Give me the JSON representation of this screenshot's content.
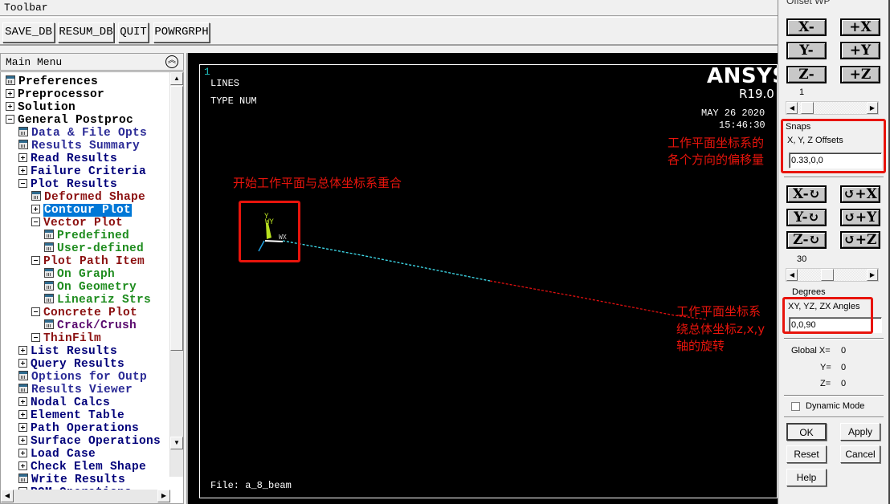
{
  "toolbar": {
    "title": "Toolbar",
    "buttons": [
      "SAVE_DB",
      "RESUM_DB",
      "QUIT",
      "POWRGRPH"
    ]
  },
  "main_menu": {
    "title": "Main Menu",
    "items": [
      {
        "label": "Preferences",
        "icon": "calc-icon",
        "level": 0,
        "color": "black"
      },
      {
        "label": "Preprocessor",
        "icon": "expand-icon",
        "level": 0,
        "color": "black"
      },
      {
        "label": "Solution",
        "icon": "expand-icon",
        "level": 0,
        "color": "black"
      },
      {
        "label": "General Postproc",
        "icon": "collapse-icon",
        "level": 0,
        "color": "black"
      },
      {
        "label": "Data & File Opts",
        "icon": "calc-icon",
        "level": 1,
        "color": "blue"
      },
      {
        "label": "Results Summary",
        "icon": "calc-icon",
        "level": 1,
        "color": "blue"
      },
      {
        "label": "Read Results",
        "icon": "expand-icon",
        "level": 1,
        "color": "navy"
      },
      {
        "label": "Failure Criteria",
        "icon": "expand-icon",
        "level": 1,
        "color": "navy"
      },
      {
        "label": "Plot Results",
        "icon": "collapse-icon",
        "level": 1,
        "color": "navy"
      },
      {
        "label": "Deformed Shape",
        "icon": "calc-icon",
        "level": 2,
        "color": "red"
      },
      {
        "label": "Contour Plot",
        "icon": "expand-icon",
        "level": 2,
        "color": "red",
        "selected": true
      },
      {
        "label": "Vector Plot",
        "icon": "collapse-icon",
        "level": 2,
        "color": "red"
      },
      {
        "label": "Predefined",
        "icon": "calc-icon",
        "level": 3,
        "color": "green"
      },
      {
        "label": "User-defined",
        "icon": "calc-icon",
        "level": 3,
        "color": "green"
      },
      {
        "label": "Plot Path Item",
        "icon": "collapse-icon",
        "level": 2,
        "color": "red"
      },
      {
        "label": "On Graph",
        "icon": "calc-icon",
        "level": 3,
        "color": "green"
      },
      {
        "label": "On Geometry",
        "icon": "calc-icon",
        "level": 3,
        "color": "green"
      },
      {
        "label": "Lineariz Strs",
        "icon": "calc-icon",
        "level": 3,
        "color": "green"
      },
      {
        "label": "Concrete Plot",
        "icon": "collapse-icon",
        "level": 2,
        "color": "red"
      },
      {
        "label": "Crack/Crush",
        "icon": "calc-icon",
        "level": 3,
        "color": "purple"
      },
      {
        "label": "ThinFilm",
        "icon": "collapse-icon",
        "level": 2,
        "color": "red"
      },
      {
        "label": "List Results",
        "icon": "expand-icon",
        "level": 1,
        "color": "navy"
      },
      {
        "label": "Query Results",
        "icon": "expand-icon",
        "level": 1,
        "color": "navy"
      },
      {
        "label": "Options for Outp",
        "icon": "calc-icon",
        "level": 1,
        "color": "blue"
      },
      {
        "label": "Results Viewer",
        "icon": "calc-icon",
        "level": 1,
        "color": "blue"
      },
      {
        "label": "Nodal Calcs",
        "icon": "expand-icon",
        "level": 1,
        "color": "navy"
      },
      {
        "label": "Element Table",
        "icon": "expand-icon",
        "level": 1,
        "color": "navy"
      },
      {
        "label": "Path Operations",
        "icon": "expand-icon",
        "level": 1,
        "color": "navy"
      },
      {
        "label": "Surface Operations",
        "icon": "expand-icon",
        "level": 1,
        "color": "navy"
      },
      {
        "label": "Load Case",
        "icon": "expand-icon",
        "level": 1,
        "color": "navy"
      },
      {
        "label": "Check Elem Shape",
        "icon": "expand-icon",
        "level": 1,
        "color": "navy"
      },
      {
        "label": "Write Results",
        "icon": "calc-icon",
        "level": 1,
        "color": "navy"
      },
      {
        "label": "ROM Operations",
        "icon": "expand-icon",
        "level": 1,
        "color": "navy"
      }
    ]
  },
  "graphics": {
    "window_number": "1",
    "plot_type": "LINES",
    "numbering": "TYPE NUM",
    "brand": "ANSYS",
    "release": "R19.0",
    "date": "MAY 26 2020",
    "time": "15:46:30",
    "file_label": "File: a_8_beam",
    "triad_labels": {
      "wy": "WY",
      "y": "Y",
      "wx": "WX"
    },
    "colors": {
      "line_cyan": "#40e0f0",
      "line_red": "#e01010",
      "triad_y": "#b8e020",
      "annotation": "#e8140c"
    }
  },
  "annotations": {
    "origin_note": "开始工作平面与总体坐标系重合",
    "offset_note": [
      "工作平面坐标系的",
      "各个方向的偏移量"
    ],
    "rotation_note": [
      "工作平面坐标系",
      "绕总体坐标z,x,y",
      "轴的旋转"
    ]
  },
  "offset_wp": {
    "title": "Offset WP",
    "translate_buttons": [
      "X-",
      "+X",
      "Y-",
      "+Y",
      "Z-",
      "+Z"
    ],
    "step_value": "1",
    "step_slider_fraction": 0.05,
    "snaps_label": "Snaps",
    "offsets_label": "X, Y, Z Offsets",
    "offsets_value": "0.33,0,0",
    "rotate_buttons": [
      "X-↻",
      "↺+X",
      "Y-↻",
      "↺+Y",
      "Z-↻",
      "↺+Z"
    ],
    "angle_step": "30",
    "angle_slider_fraction": 0.4,
    "degrees_label": "Degrees",
    "angles_label": "XY, YZ, ZX Angles",
    "angles_value": "0,0,90",
    "global_x_label": "Global X=",
    "global_x": "0",
    "global_y_label": "Y=",
    "global_y": "0",
    "global_z_label": "Z=",
    "global_z": "0",
    "dynamic_mode_label": "Dynamic Mode",
    "dynamic_mode_checked": false,
    "buttons": {
      "ok": "OK",
      "apply": "Apply",
      "reset": "Reset",
      "cancel": "Cancel",
      "help": "Help"
    }
  }
}
